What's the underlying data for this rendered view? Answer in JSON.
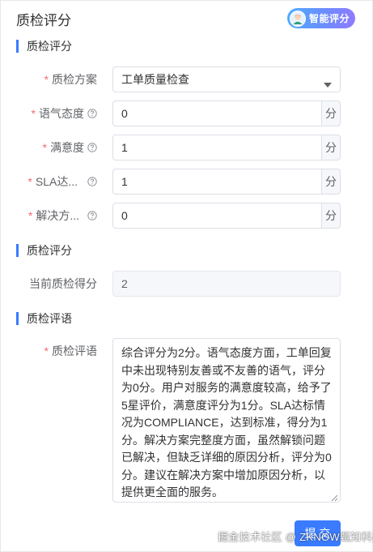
{
  "header": {
    "title": "质检评分",
    "ai_button_label": "智能评分",
    "ai_button_icon": "robot-avatar-icon"
  },
  "section_plan": {
    "title": "质检评分"
  },
  "form": {
    "plan": {
      "required": "*",
      "label": "质检方案",
      "value": "工单质量检查"
    },
    "tone": {
      "required": "*",
      "label": "语气态度",
      "value": "0",
      "unit": "分"
    },
    "satisfaction": {
      "required": "*",
      "label": "满意度",
      "value": "1",
      "unit": "分"
    },
    "sla": {
      "required": "*",
      "label": "SLA达...",
      "value": "1",
      "unit": "分"
    },
    "solution": {
      "required": "*",
      "label": "解决方...",
      "value": "0",
      "unit": "分"
    }
  },
  "section_score": {
    "title": "质检评分"
  },
  "current_score": {
    "label": "当前质检得分",
    "value": "2"
  },
  "section_comment": {
    "title": "质检评语"
  },
  "comment": {
    "required": "*",
    "label": "质检评语",
    "lines": [
      "综合评分为2分。语气态度方面，工单回复",
      "中未出现特别友善或不友善的语气，评分",
      "为0分。用户对服务的满意度较高，给予了",
      "5星评价，满意度评分为1分。SLA达标情",
      "况为COMPLIANCE，达到标准，得分为1",
      "分。解决方案完整度方面，虽然解锁问题",
      "已解决，但缺乏详细的原因分析，评分为0",
      "分。建议在解决方案中增加原因分析，以",
      "提供更全面的服务。"
    ]
  },
  "submit_label": "提 交",
  "watermark": "掘金技术社区 @ ZKNOW甄知科技",
  "colors": {
    "accent": "#3a7bff",
    "required": "#f56c6c"
  }
}
